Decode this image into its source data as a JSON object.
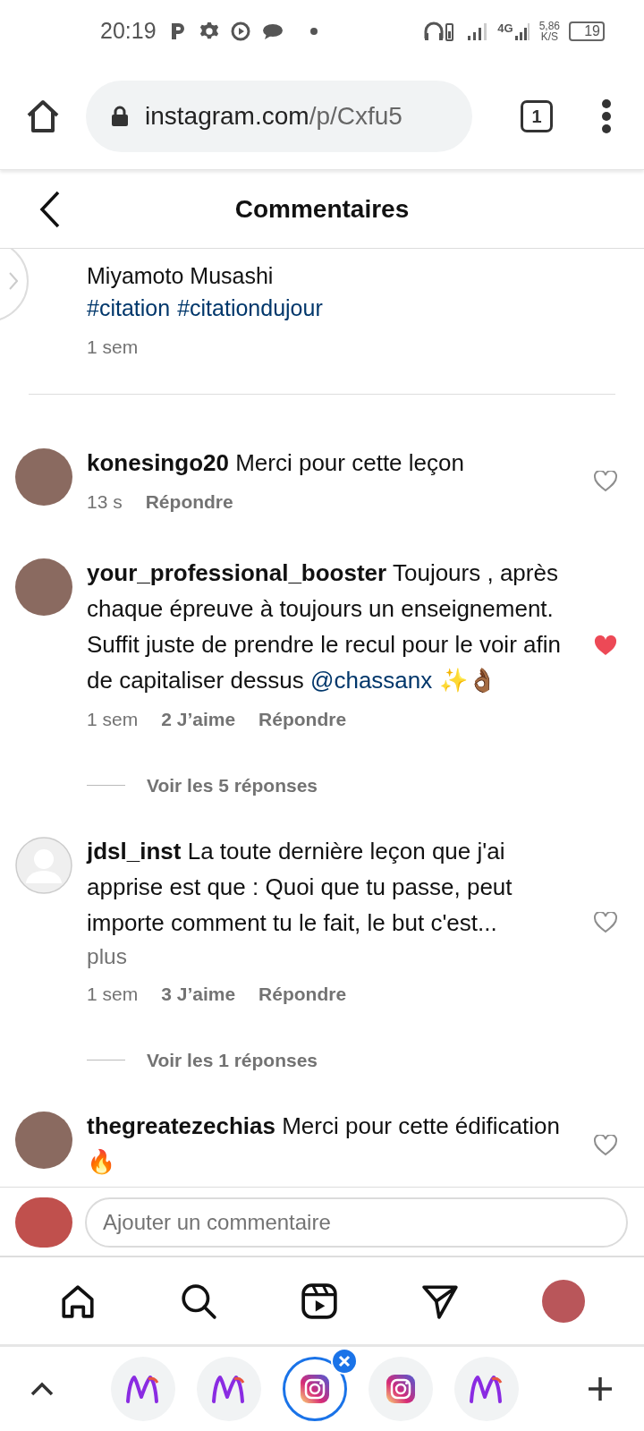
{
  "status_bar": {
    "time": "20:19",
    "network": "4G",
    "speed": "5,86",
    "speed_unit": "K/S",
    "battery": "19"
  },
  "browser": {
    "url_host": "instagram.com",
    "url_path": "/p/Cxfu5",
    "tab_count": "1"
  },
  "header": {
    "title": "Commentaires"
  },
  "caption": {
    "author_line": "Miyamoto Musashi",
    "hashtags": [
      "#citation",
      "#citationdujour"
    ],
    "time": "1 sem"
  },
  "comments": [
    {
      "username": "konesingo20",
      "text": "Merci pour cette leçon",
      "time": "13 s",
      "reply": "Répondre",
      "liked": false,
      "kind": "photo"
    },
    {
      "username": "your_professional_booster",
      "text": "Toujours , après chaque épreuve à toujours un enseignement. Suffit juste de prendre le recul pour le voir afin de capitaliser dessus",
      "mention": "@chassanx",
      "emoji": "✨👌🏾",
      "time": "1 sem",
      "likes": "2 J’aime",
      "reply": "Répondre",
      "liked": true,
      "kind": "photo",
      "view_replies": "Voir les 5 réponses"
    },
    {
      "username": "jdsl_inst",
      "text": "La toute dernière leçon que j'ai apprise est que : Quoi que tu passe, peut importe comment tu le fait, le but c'est...",
      "more": "plus",
      "time": "1 sem",
      "likes": "3 J’aime",
      "reply": "Répondre",
      "liked": false,
      "kind": "placeholder",
      "view_replies": "Voir les 1 réponses"
    },
    {
      "username": "thegreatezechias",
      "text": "Merci pour cette édification 🔥",
      "liked": false,
      "kind": "photo"
    }
  ],
  "composer": {
    "placeholder": "Ajouter un commentaire"
  },
  "bottom_nav": [
    {
      "kind": "home"
    },
    {
      "kind": "search"
    },
    {
      "kind": "reels"
    },
    {
      "kind": "direct"
    },
    {
      "kind": "profile"
    }
  ],
  "tab_strip": [
    {
      "kind": "m-logo",
      "selected": false
    },
    {
      "kind": "m-logo",
      "selected": false
    },
    {
      "kind": "instagram",
      "selected": true
    },
    {
      "kind": "instagram",
      "selected": false
    },
    {
      "kind": "m-logo",
      "selected": false
    }
  ]
}
